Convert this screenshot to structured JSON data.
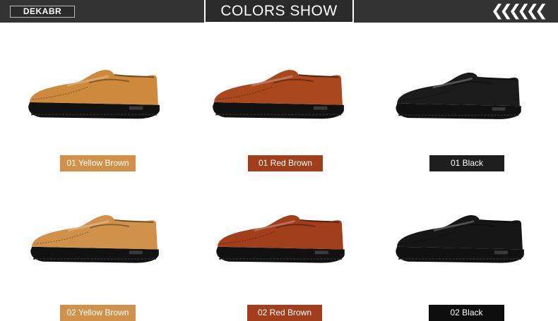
{
  "header": {
    "logo": "DEKABR",
    "title": "COLORS SHOW",
    "chevrons": "❮❮❮❮❮❮"
  },
  "colors": {
    "yellow_brown": "#d0924a",
    "red_brown": "#a13e1c",
    "black": "#1e1e1e"
  },
  "variants": [
    {
      "label": "01 Yellow Brown"
    },
    {
      "label": "01 Red Brown"
    },
    {
      "label": "01 Black"
    },
    {
      "label": "02 Yellow Brown"
    },
    {
      "label": "02 Red Brown"
    },
    {
      "label": "02 Black"
    }
  ]
}
